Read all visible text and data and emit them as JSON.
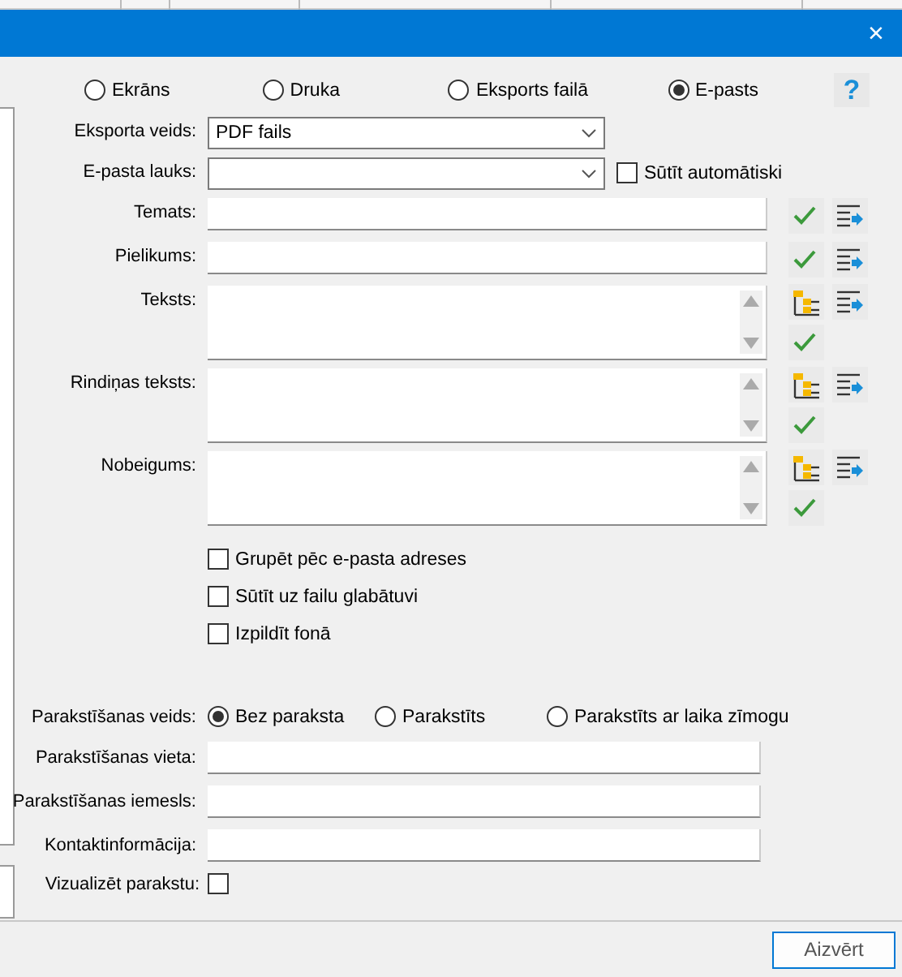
{
  "window": {
    "close": "×"
  },
  "output_modes": [
    {
      "label": "Ekrāns",
      "selected": false
    },
    {
      "label": "Druka",
      "selected": false
    },
    {
      "label": "Eksports failā",
      "selected": false
    },
    {
      "label": "E-pasts",
      "selected": true
    }
  ],
  "help": "?",
  "fields": [
    {
      "kind": "dropdown",
      "label": "Eksporta veids:",
      "value": "PDF fails"
    },
    {
      "kind": "dropdown",
      "label": "E-pasta lauks:",
      "checkbox": {
        "label": "Sūtīt automātiski",
        "checked": false
      }
    },
    {
      "kind": "text",
      "label": "Temats:"
    },
    {
      "kind": "text",
      "label": "Pielikums:"
    },
    {
      "kind": "textarea",
      "label": "Teksts:"
    },
    {
      "kind": "textarea",
      "label": "Rindiņas teksts:"
    },
    {
      "kind": "textarea",
      "label": "Nobeigums:"
    }
  ],
  "options": [
    {
      "label": "Grupēt pēc e-pasta adreses",
      "checked": false
    },
    {
      "label": "Sūtīt uz failu glabātuvi",
      "checked": false
    },
    {
      "label": "Izpildīt fonā",
      "checked": false
    }
  ],
  "signing": {
    "label": "Parakstīšanas veids:",
    "types": [
      {
        "label": "Bez paraksta",
        "selected": true
      },
      {
        "label": "Parakstīts",
        "selected": false
      },
      {
        "label": "Parakstīts ar laika zīmogu",
        "selected": false
      }
    ]
  },
  "signing_fields": [
    {
      "label": "Parakstīšanas vieta:"
    },
    {
      "label": "Parakstīšanas iemesls:"
    },
    {
      "label": "Kontaktinformācija:"
    }
  ],
  "visualize": {
    "label": "Vizualizēt parakstu:",
    "checked": false
  },
  "close_button": "Aizvērt"
}
